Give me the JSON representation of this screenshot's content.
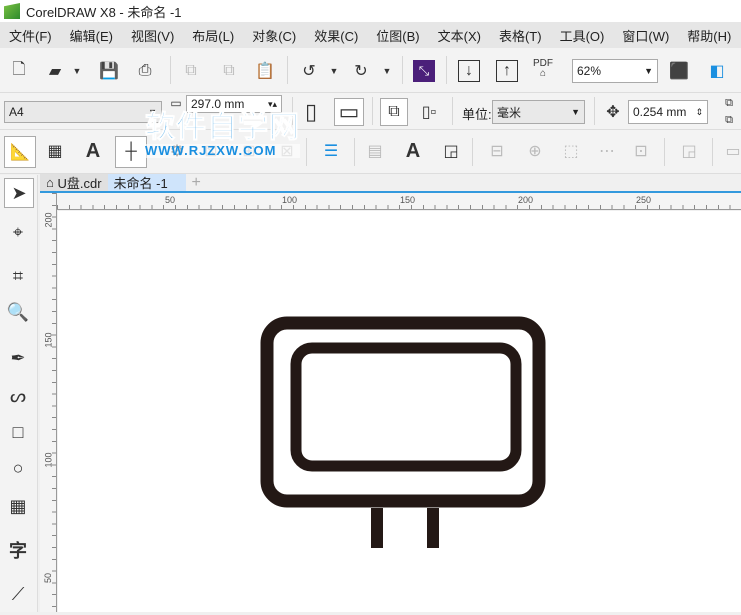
{
  "title": "CorelDRAW X8 - 未命名 -1",
  "menu": [
    "文件(F)",
    "编辑(E)",
    "视图(V)",
    "布局(L)",
    "对象(C)",
    "效果(C)",
    "位图(B)",
    "文本(X)",
    "表格(T)",
    "工具(O)",
    "窗口(W)",
    "帮助(H)"
  ],
  "toolbar": {
    "zoom": "62%",
    "pdf_label": "PDF"
  },
  "property_bar": {
    "page_size": "A4",
    "width": "297.0 mm",
    "unit_label": "单位:",
    "unit": "毫米",
    "nudge": "0.254 mm"
  },
  "tabs": [
    {
      "label": "U盘.cdr"
    },
    {
      "label": "未命名 -1",
      "active": true
    }
  ],
  "ruler": {
    "h": [
      "50",
      "100",
      "150",
      "200",
      "250"
    ],
    "v": [
      "200",
      "150",
      "100",
      "50"
    ]
  },
  "toolbox": {
    "text_tool": "字"
  },
  "watermark": {
    "line1": "软件自学网",
    "line2": "WWW.RJZXW.COM"
  },
  "colors": {
    "shape_stroke": "#231815",
    "accent": "#3399dd",
    "watermark": "#1a8fe0"
  }
}
